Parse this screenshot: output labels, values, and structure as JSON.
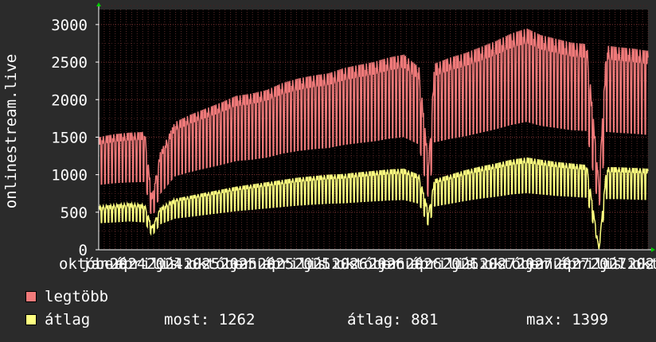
{
  "chart_data": {
    "type": "line",
    "ylabel": "onlinestream.live",
    "xlabel": "",
    "ylim": [
      0,
      3200
    ],
    "yticks": [
      0,
      500,
      1000,
      1500,
      2000,
      2500,
      3000
    ],
    "x_tick_labels": [
      "október",
      "január",
      "2024",
      "április",
      "2024",
      "július",
      "2025",
      "október",
      "2025",
      "január",
      "2025",
      "április",
      "2025",
      "július",
      "2026",
      "október",
      "2026",
      "január",
      "2026",
      "április",
      "2026",
      "július",
      "2027",
      "október",
      "2027",
      "január",
      "2027",
      "április",
      "2027",
      "július",
      "2027",
      "október"
    ],
    "x_domain": [
      "2023-10-01",
      "2026-10-01"
    ],
    "series": [
      {
        "name": "legtöbb",
        "color": "#f07a7a",
        "points": [
          [
            "2023-10-01",
            1500
          ],
          [
            "2023-11-01",
            1540
          ],
          [
            "2023-12-01",
            1560
          ],
          [
            "2024-01-01",
            1570
          ],
          [
            "2024-01-15",
            700
          ],
          [
            "2024-02-01",
            1300
          ],
          [
            "2024-03-01",
            1700
          ],
          [
            "2024-04-01",
            1800
          ],
          [
            "2024-05-01",
            1880
          ],
          [
            "2024-06-01",
            1960
          ],
          [
            "2024-07-01",
            2050
          ],
          [
            "2024-08-01",
            2080
          ],
          [
            "2024-09-01",
            2130
          ],
          [
            "2024-10-01",
            2220
          ],
          [
            "2024-11-01",
            2280
          ],
          [
            "2024-12-01",
            2320
          ],
          [
            "2025-01-01",
            2350
          ],
          [
            "2025-02-01",
            2420
          ],
          [
            "2025-03-01",
            2460
          ],
          [
            "2025-04-01",
            2500
          ],
          [
            "2025-05-01",
            2560
          ],
          [
            "2025-06-01",
            2600
          ],
          [
            "2025-07-01",
            2430
          ],
          [
            "2025-07-20",
            1150
          ],
          [
            "2025-08-01",
            2480
          ],
          [
            "2025-09-01",
            2560
          ],
          [
            "2025-10-01",
            2620
          ],
          [
            "2025-11-01",
            2700
          ],
          [
            "2025-12-01",
            2780
          ],
          [
            "2026-01-01",
            2880
          ],
          [
            "2026-02-01",
            2950
          ],
          [
            "2026-03-01",
            2860
          ],
          [
            "2026-04-01",
            2810
          ],
          [
            "2026-05-01",
            2760
          ],
          [
            "2026-06-01",
            2740
          ],
          [
            "2026-06-25",
            900
          ],
          [
            "2026-07-10",
            2720
          ],
          [
            "2026-08-01",
            2700
          ],
          [
            "2026-09-01",
            2680
          ],
          [
            "2026-10-01",
            2650
          ]
        ]
      },
      {
        "name": "átlag",
        "color": "#ffff80",
        "points": [
          [
            "2023-10-01",
            580
          ],
          [
            "2023-11-01",
            600
          ],
          [
            "2023-12-01",
            620
          ],
          [
            "2024-01-01",
            600
          ],
          [
            "2024-01-15",
            300
          ],
          [
            "2024-02-01",
            560
          ],
          [
            "2024-03-01",
            680
          ],
          [
            "2024-04-01",
            720
          ],
          [
            "2024-05-01",
            760
          ],
          [
            "2024-06-01",
            800
          ],
          [
            "2024-07-01",
            840
          ],
          [
            "2024-08-01",
            870
          ],
          [
            "2024-09-01",
            900
          ],
          [
            "2024-10-01",
            930
          ],
          [
            "2024-11-01",
            960
          ],
          [
            "2024-12-01",
            980
          ],
          [
            "2025-01-01",
            1000
          ],
          [
            "2025-02-01",
            1010
          ],
          [
            "2025-03-01",
            1030
          ],
          [
            "2025-04-01",
            1050
          ],
          [
            "2025-05-01",
            1070
          ],
          [
            "2025-06-01",
            1080
          ],
          [
            "2025-07-01",
            1000
          ],
          [
            "2025-07-20",
            500
          ],
          [
            "2025-08-01",
            940
          ],
          [
            "2025-09-01",
            1000
          ],
          [
            "2025-10-01",
            1060
          ],
          [
            "2025-11-01",
            1110
          ],
          [
            "2025-12-01",
            1150
          ],
          [
            "2026-01-01",
            1200
          ],
          [
            "2026-02-01",
            1230
          ],
          [
            "2026-03-01",
            1200
          ],
          [
            "2026-04-01",
            1170
          ],
          [
            "2026-05-01",
            1150
          ],
          [
            "2026-06-01",
            1130
          ],
          [
            "2026-06-25",
            10
          ],
          [
            "2026-07-10",
            1100
          ],
          [
            "2026-08-01",
            1100
          ],
          [
            "2026-09-01",
            1090
          ],
          [
            "2026-10-01",
            1080
          ]
        ]
      }
    ],
    "grid": true
  },
  "legend": {
    "max_label": "legtöbb",
    "avg_label": "átlag",
    "max_color": "#f07a7a",
    "avg_color": "#ffff80",
    "stat_now": "most: 1262",
    "stat_avg": "átlag: 881",
    "stat_max": "max: 1399"
  }
}
